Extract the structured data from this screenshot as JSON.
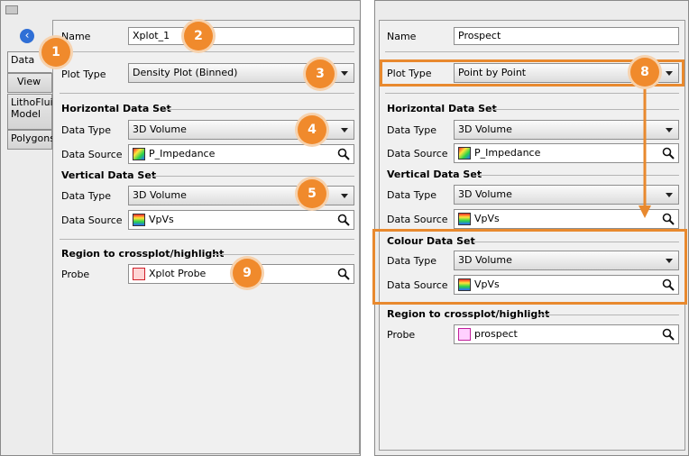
{
  "left": {
    "tabs": [
      {
        "label": "Data"
      },
      {
        "label": "View"
      },
      {
        "label": "LithoFluid Model"
      },
      {
        "label": "Polygons"
      }
    ],
    "name_label": "Name",
    "name_value": "Xplot_1",
    "plot_type_label": "Plot Type",
    "plot_type_value": "Density Plot (Binned)",
    "horizontal": {
      "header": "Horizontal Data Set",
      "data_type_label": "Data Type",
      "data_type_value": "3D Volume",
      "data_source_label": "Data Source",
      "data_source_value": "P_Impedance"
    },
    "vertical": {
      "header": "Vertical Data Set",
      "data_type_label": "Data Type",
      "data_type_value": "3D Volume",
      "data_source_label": "Data Source",
      "data_source_value": "VpVs"
    },
    "region": {
      "header": "Region to crossplot/highlight",
      "probe_label": "Probe",
      "probe_value": "Xplot Probe"
    }
  },
  "right": {
    "name_label": "Name",
    "name_value": "Prospect",
    "plot_type_label": "Plot Type",
    "plot_type_value": "Point by Point",
    "horizontal": {
      "header": "Horizontal Data Set",
      "data_type_label": "Data Type",
      "data_type_value": "3D Volume",
      "data_source_label": "Data Source",
      "data_source_value": "P_Impedance"
    },
    "vertical": {
      "header": "Vertical Data Set",
      "data_type_label": "Data Type",
      "data_type_value": "3D Volume",
      "data_source_label": "Data Source",
      "data_source_value": "VpVs"
    },
    "colour": {
      "header": "Colour Data Set",
      "data_type_label": "Data Type",
      "data_type_value": "3D Volume",
      "data_source_label": "Data Source",
      "data_source_value": "VpVs"
    },
    "region": {
      "header": "Region to crossplot/highlight",
      "probe_label": "Probe",
      "probe_value": "prospect"
    }
  },
  "callouts": [
    "1",
    "2",
    "3",
    "4",
    "5",
    "9",
    "8"
  ],
  "colors": {
    "callout": "#f08a2c",
    "highlight": "#e8892e"
  }
}
